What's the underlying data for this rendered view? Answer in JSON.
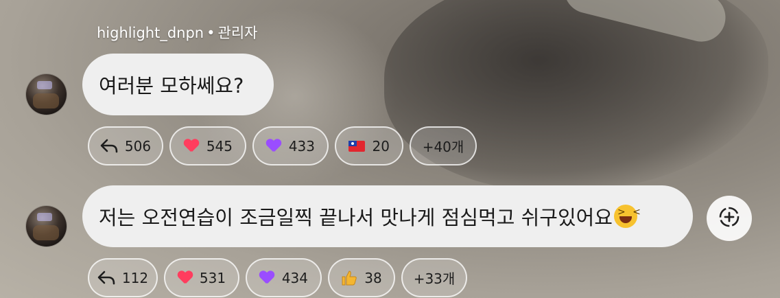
{
  "messages": [
    {
      "sender": "highlight_dnpn",
      "role": "관리자",
      "separator": "•",
      "text": "여러분 모하쎄요?",
      "reactions": {
        "reply_count": "506",
        "red_heart": "545",
        "purple_heart": "433",
        "flag": "20",
        "more": "+40개"
      }
    },
    {
      "text": "저는 오전연습이 조금일찍 끝나서 맛나게 점심먹고 쉬구있어요",
      "emoji": "grinning-squinting-face",
      "reactions": {
        "reply_count": "112",
        "red_heart": "531",
        "purple_heart": "434",
        "thumbs_up": "38",
        "more": "+33개"
      }
    }
  ],
  "icons": [
    "reply-arrow-icon",
    "red-heart-icon",
    "purple-heart-icon",
    "taiwan-flag-icon",
    "thumbs-up-icon",
    "add-reaction-icon"
  ],
  "colors": {
    "bubble": "#efefef",
    "red_heart": "#ff3d5e",
    "purple_heart": "#9a4dff"
  }
}
